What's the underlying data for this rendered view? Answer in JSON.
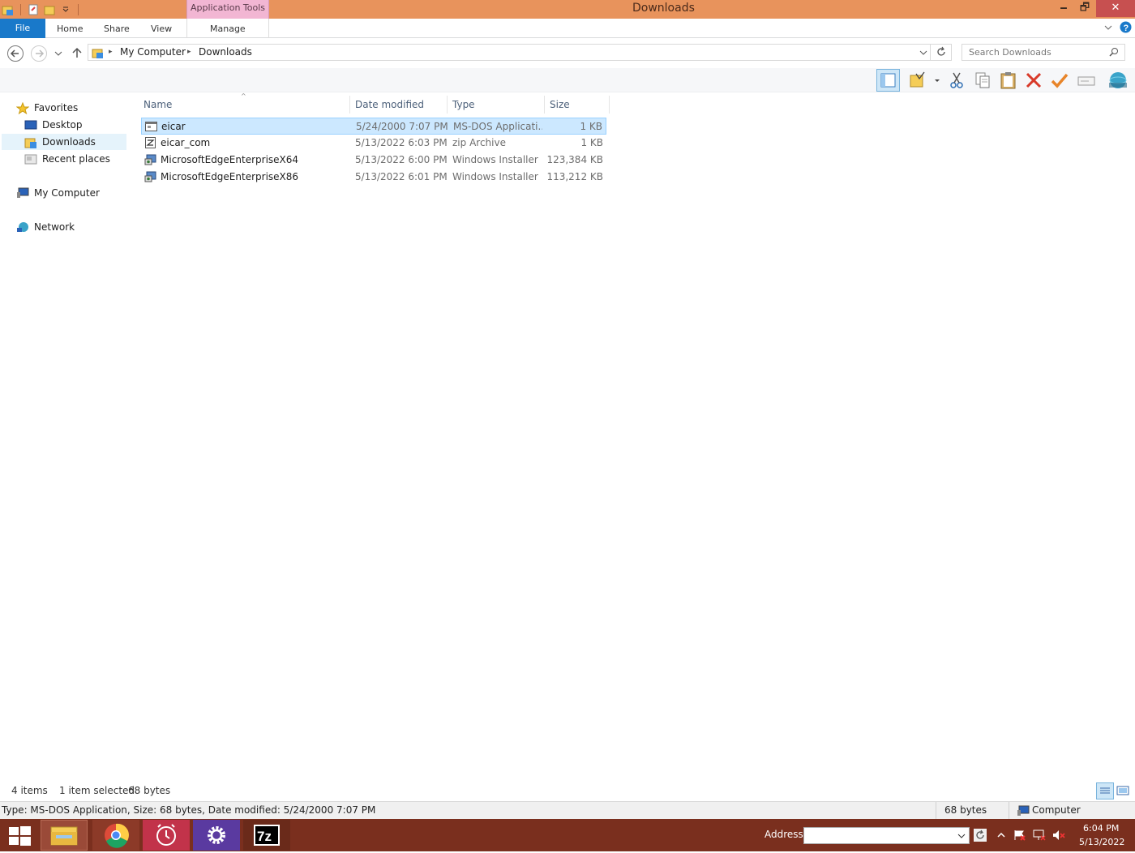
{
  "titlebar": {
    "title": "Downloads",
    "context_tab": "Application Tools",
    "minimize": "🗕",
    "restore": "🗗",
    "close": "✕"
  },
  "ribbon": {
    "file": "File",
    "tabs": [
      "Home",
      "Share",
      "View",
      "Manage"
    ]
  },
  "address": {
    "crumbs": [
      "My Computer",
      "Downloads"
    ],
    "search_placeholder": "Search Downloads"
  },
  "nav": {
    "favorites": "Favorites",
    "desktop": "Desktop",
    "downloads": "Downloads",
    "recent": "Recent places",
    "computer": "My Computer",
    "network": "Network"
  },
  "columns": {
    "name": "Name",
    "date": "Date modified",
    "type": "Type",
    "size": "Size"
  },
  "files": [
    {
      "name": "eicar",
      "date": "5/24/2000 7:07 PM",
      "type": "MS-DOS Applicati...",
      "size": "1 KB",
      "selected": true
    },
    {
      "name": "eicar_com",
      "date": "5/13/2022 6:03 PM",
      "type": "zip Archive",
      "size": "1 KB"
    },
    {
      "name": "MicrosoftEdgeEnterpriseX64",
      "date": "5/13/2022 6:00 PM",
      "type": "Windows Installer ...",
      "size": "123,384 KB"
    },
    {
      "name": "MicrosoftEdgeEnterpriseX86",
      "date": "5/13/2022 6:01 PM",
      "type": "Windows Installer ...",
      "size": "113,212 KB"
    }
  ],
  "status": {
    "items": "4 items",
    "selection": "1 item selected",
    "selection_size": "68 bytes"
  },
  "details": {
    "info": "Type: MS-DOS Application, Size: 68 bytes, Date modified: 5/24/2000 7:07 PM",
    "size": "68 bytes",
    "zone": "Computer"
  },
  "taskbar": {
    "address_label": "Address",
    "time": "6:04 PM",
    "date": "5/13/2022"
  },
  "colors": {
    "titlebar": "#e8935c",
    "taskbar": "#7a2f1e",
    "accent": "#1979ca",
    "selection": "#cce8ff"
  }
}
